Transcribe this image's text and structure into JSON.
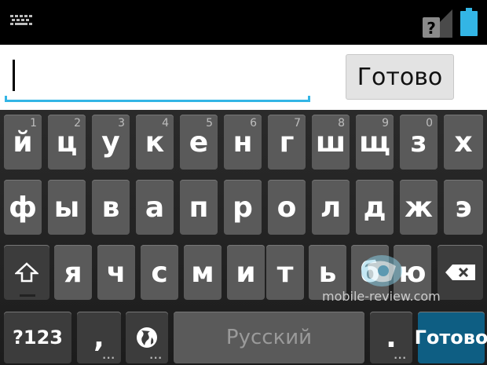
{
  "status_bar": {
    "icons": [
      "keyboard-notification-icon",
      "no-sim-signal-icon",
      "battery-icon"
    ],
    "accent": "#33b5e5"
  },
  "input": {
    "value": "",
    "done_label": "Готово",
    "accent": "#33b5e5"
  },
  "keyboard": {
    "row1": [
      {
        "label": "й",
        "hint": "1"
      },
      {
        "label": "ц",
        "hint": "2"
      },
      {
        "label": "у",
        "hint": "3"
      },
      {
        "label": "к",
        "hint": "4"
      },
      {
        "label": "е",
        "hint": "5"
      },
      {
        "label": "н",
        "hint": "6"
      },
      {
        "label": "г",
        "hint": "7"
      },
      {
        "label": "ш",
        "hint": "8"
      },
      {
        "label": "щ",
        "hint": "9"
      },
      {
        "label": "з",
        "hint": "0"
      },
      {
        "label": "х",
        "hint": ""
      }
    ],
    "row2": [
      {
        "label": "ф"
      },
      {
        "label": "ы"
      },
      {
        "label": "в"
      },
      {
        "label": "а"
      },
      {
        "label": "п"
      },
      {
        "label": "р"
      },
      {
        "label": "о"
      },
      {
        "label": "л"
      },
      {
        "label": "д"
      },
      {
        "label": "ж"
      },
      {
        "label": "э"
      }
    ],
    "row3": [
      {
        "label": "я"
      },
      {
        "label": "ч"
      },
      {
        "label": "с"
      },
      {
        "label": "м"
      },
      {
        "label": "и"
      },
      {
        "label": "т"
      },
      {
        "label": "ь"
      },
      {
        "label": "б"
      },
      {
        "label": "ю"
      }
    ],
    "shift_icon": "shift-arrow-icon",
    "backspace_icon": "backspace-icon",
    "symbols_label": "?123",
    "comma_label": ",",
    "language_icon": "globe-icon",
    "space_label": "Русский",
    "period_label": ".",
    "action_label": "Готово",
    "action_color": "#0e5e83"
  },
  "watermark": "mobile-review.com"
}
